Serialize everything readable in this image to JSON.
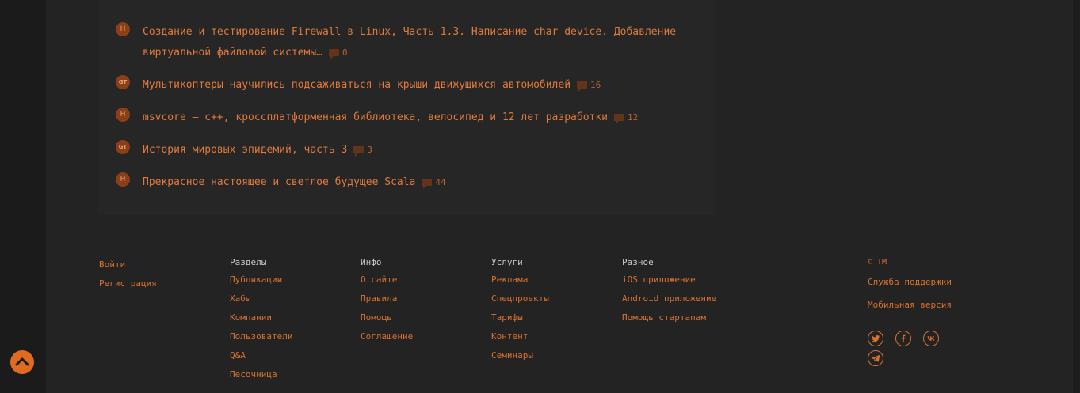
{
  "posts": [
    {
      "icon": "Н",
      "title": "Создание и тестирование Firewall в Linux, Часть 1.3. Написание char device. Добавление виртуальной файловой системы…",
      "comments": "0"
    },
    {
      "icon": "GT",
      "title": "Мультикоптеры научились подсаживаться на крыши движущихся автомобилей",
      "comments": "16"
    },
    {
      "icon": "Н",
      "title": "msvcore – c++, кроссплатформенная библиотека, велосипед и 12 лет разработки",
      "comments": "12"
    },
    {
      "icon": "GT",
      "title": "История мировых эпидемий, часть 3",
      "comments": "3"
    },
    {
      "icon": "Н",
      "title": "Прекрасное настоящее и светлое будущее Scala",
      "comments": "44"
    }
  ],
  "footer": {
    "auth": {
      "login": "Войти",
      "register": "Регистрация"
    },
    "sections": {
      "title": "Разделы",
      "links": [
        "Публикации",
        "Хабы",
        "Компании",
        "Пользователи",
        "Q&A",
        "Песочница"
      ]
    },
    "info": {
      "title": "Инфо",
      "links": [
        "О сайте",
        "Правила",
        "Помощь",
        "Соглашение"
      ]
    },
    "services": {
      "title": "Услуги",
      "links": [
        "Реклама",
        "Спецпроекты",
        "Тарифы",
        "Контент",
        "Семинары"
      ]
    },
    "misc": {
      "title": "Разное",
      "links": [
        "iOS приложение",
        "Android приложение",
        "Помощь стартапам"
      ]
    },
    "tm": {
      "copyright": "© TM",
      "support": "Служба поддержки",
      "mobile": "Мобильная версия"
    },
    "socials": [
      "twitter-icon",
      "facebook-icon",
      "vk-icon",
      "telegram-icon"
    ]
  },
  "colors": {
    "accent": "#d9712f",
    "scroll_button": "#e06a1f"
  }
}
